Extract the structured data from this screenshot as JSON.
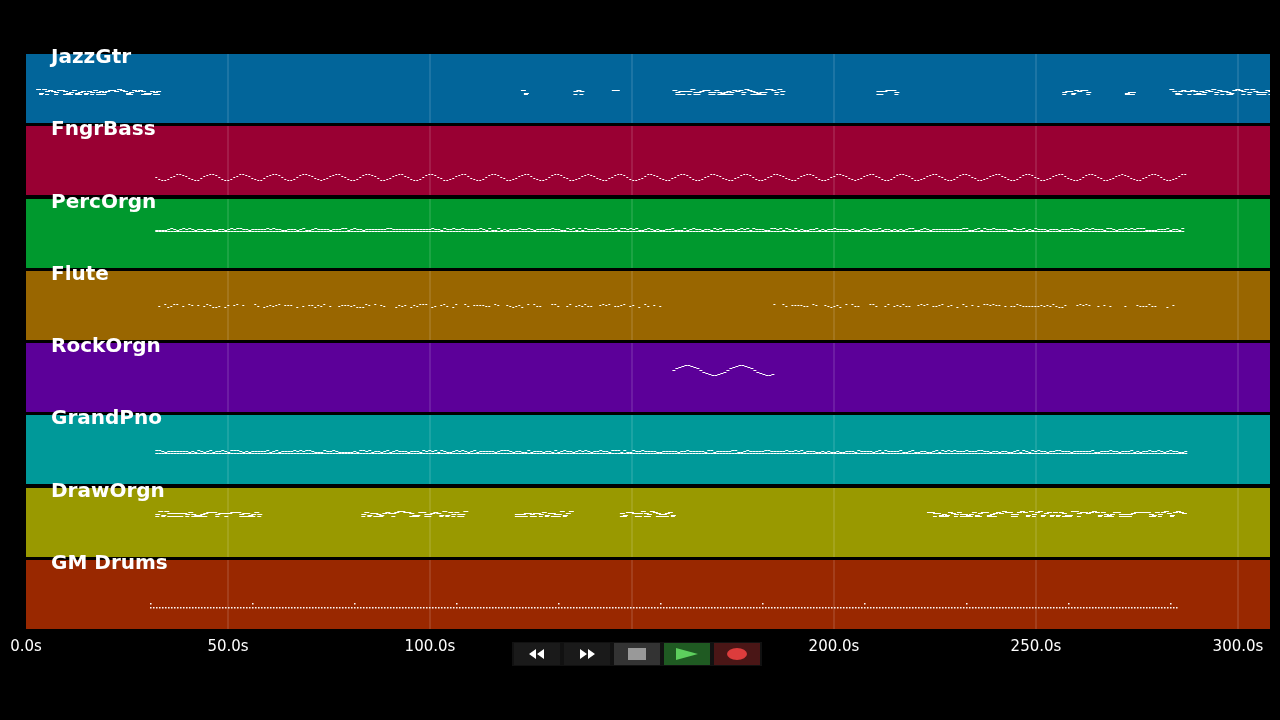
{
  "tracks": [
    {
      "name": "JazzGtr",
      "color": "#02659a"
    },
    {
      "name": "FngrBass",
      "color": "#990033"
    },
    {
      "name": "PercOrgn",
      "color": "#00992e"
    },
    {
      "name": "Flute",
      "color": "#996600"
    },
    {
      "name": "RockOrgn",
      "color": "#5c0099"
    },
    {
      "name": "GrandPno",
      "color": "#009999"
    },
    {
      "name": "DrawOrgn",
      "color": "#999900"
    },
    {
      "name": "GM Drums",
      "color": "#992800"
    }
  ],
  "time_axis": {
    "ticks": [
      {
        "label": "0.0s",
        "kind": "tick"
      },
      {
        "label": "50.0s",
        "kind": "tick"
      },
      {
        "label": "100.0s",
        "kind": "tick"
      },
      {
        "kind": "hidden"
      },
      {
        "label": "200.0s",
        "kind": "tick"
      },
      {
        "label": "250.0s",
        "kind": "tick"
      },
      {
        "label": "300.0s",
        "kind": "tick"
      }
    ]
  },
  "transport": [
    {
      "kind": "rewind"
    },
    {
      "kind": "forward"
    },
    {
      "kind": "stop"
    },
    {
      "kind": "play"
    },
    {
      "kind": "record"
    }
  ]
}
